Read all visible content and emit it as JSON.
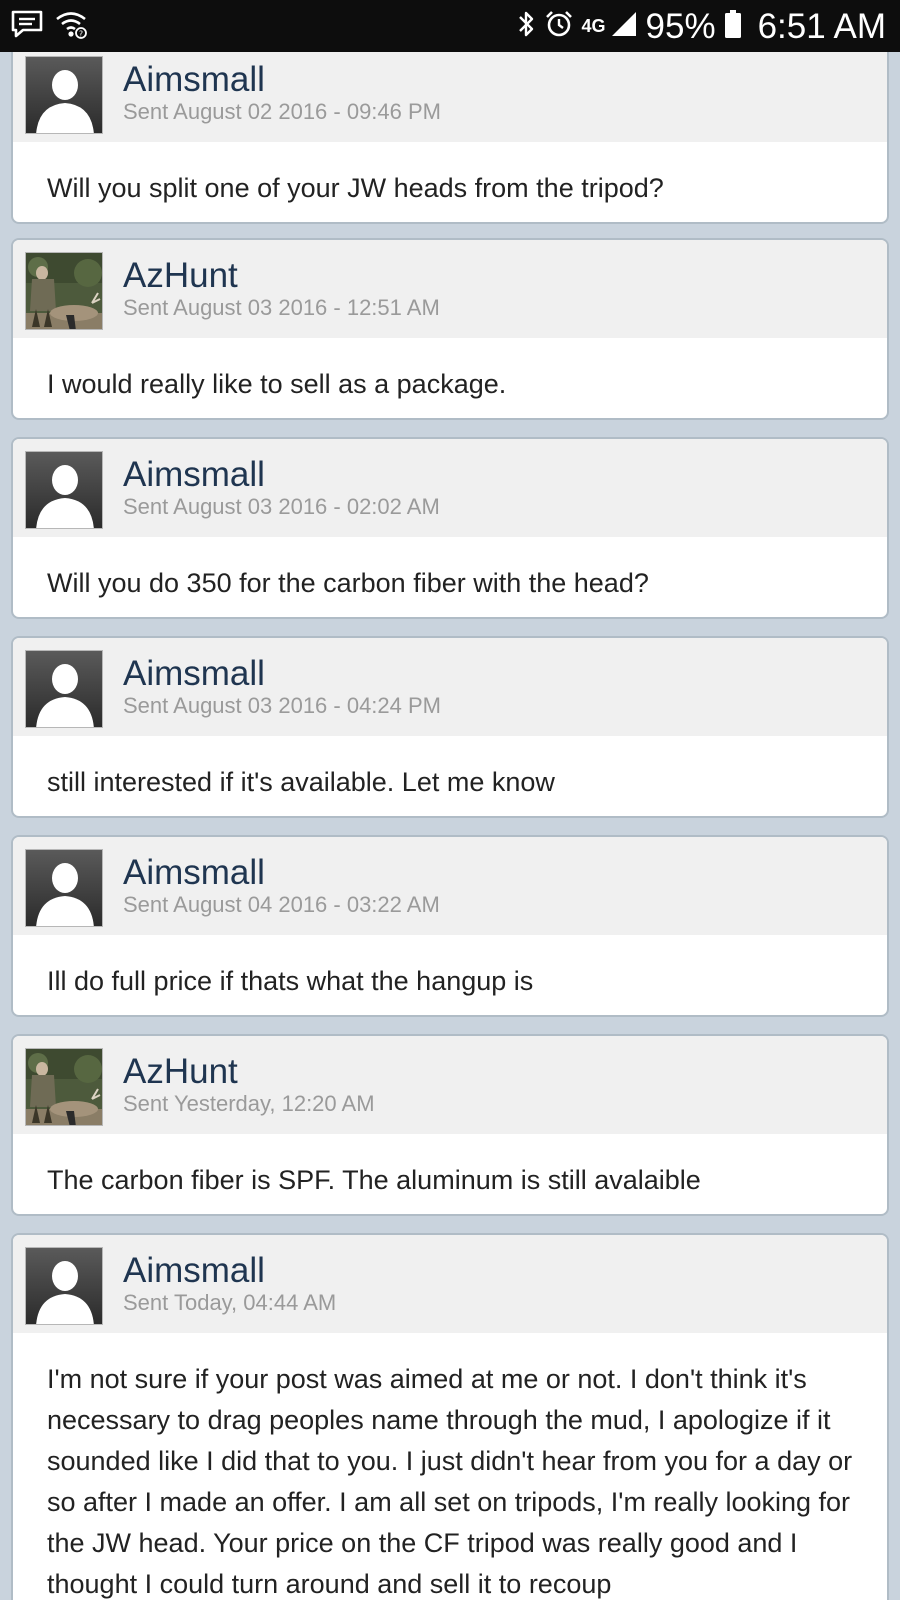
{
  "status_bar": {
    "network": "4G",
    "battery_percent": "95%",
    "time": "6:51 AM",
    "icons": [
      "message-icon",
      "wifi-icon",
      "bluetooth-icon",
      "alarm-icon",
      "lte-icon",
      "signal-icon",
      "battery-icon"
    ]
  },
  "messages": [
    {
      "author": "Aimsmall",
      "sent": "Sent August 02 2016 - 09:46 PM",
      "body": "Will you split one of your JW heads from the tripod?",
      "avatar": "default-user-icon"
    },
    {
      "author": "AzHunt",
      "sent": "Sent August 03 2016 - 12:51 AM",
      "body": "I would really like to sell as a package.",
      "avatar": "hunter-photo"
    },
    {
      "author": "Aimsmall",
      "sent": "Sent August 03 2016 - 02:02 AM",
      "body": "Will you do 350 for the carbon fiber with the head?",
      "avatar": "default-user-icon"
    },
    {
      "author": "Aimsmall",
      "sent": "Sent August 03 2016 - 04:24 PM",
      "body": "still interested if it's available.  Let me know",
      "avatar": "default-user-icon"
    },
    {
      "author": "Aimsmall",
      "sent": "Sent August 04 2016 - 03:22 AM",
      "body": "Ill do full price if thats what the hangup is",
      "avatar": "default-user-icon"
    },
    {
      "author": "AzHunt",
      "sent": "Sent Yesterday, 12:20 AM",
      "body": "The carbon fiber is SPF. The aluminum is still avalaible",
      "avatar": "hunter-photo"
    },
    {
      "author": "Aimsmall",
      "sent": "Sent Today, 04:44 AM",
      "body": "I'm not sure if your post was aimed at me or not. I don't think it's necessary to drag peoples name through the mud, I apologize if it sounded like I did that to you. I just didn't hear from you for a day or so after I made an offer. I am all set on tripods, I'm really looking for the JW head. Your price on the CF tripod was really good and I thought I could turn around and sell it to recoup",
      "avatar": "default-user-icon"
    }
  ]
}
